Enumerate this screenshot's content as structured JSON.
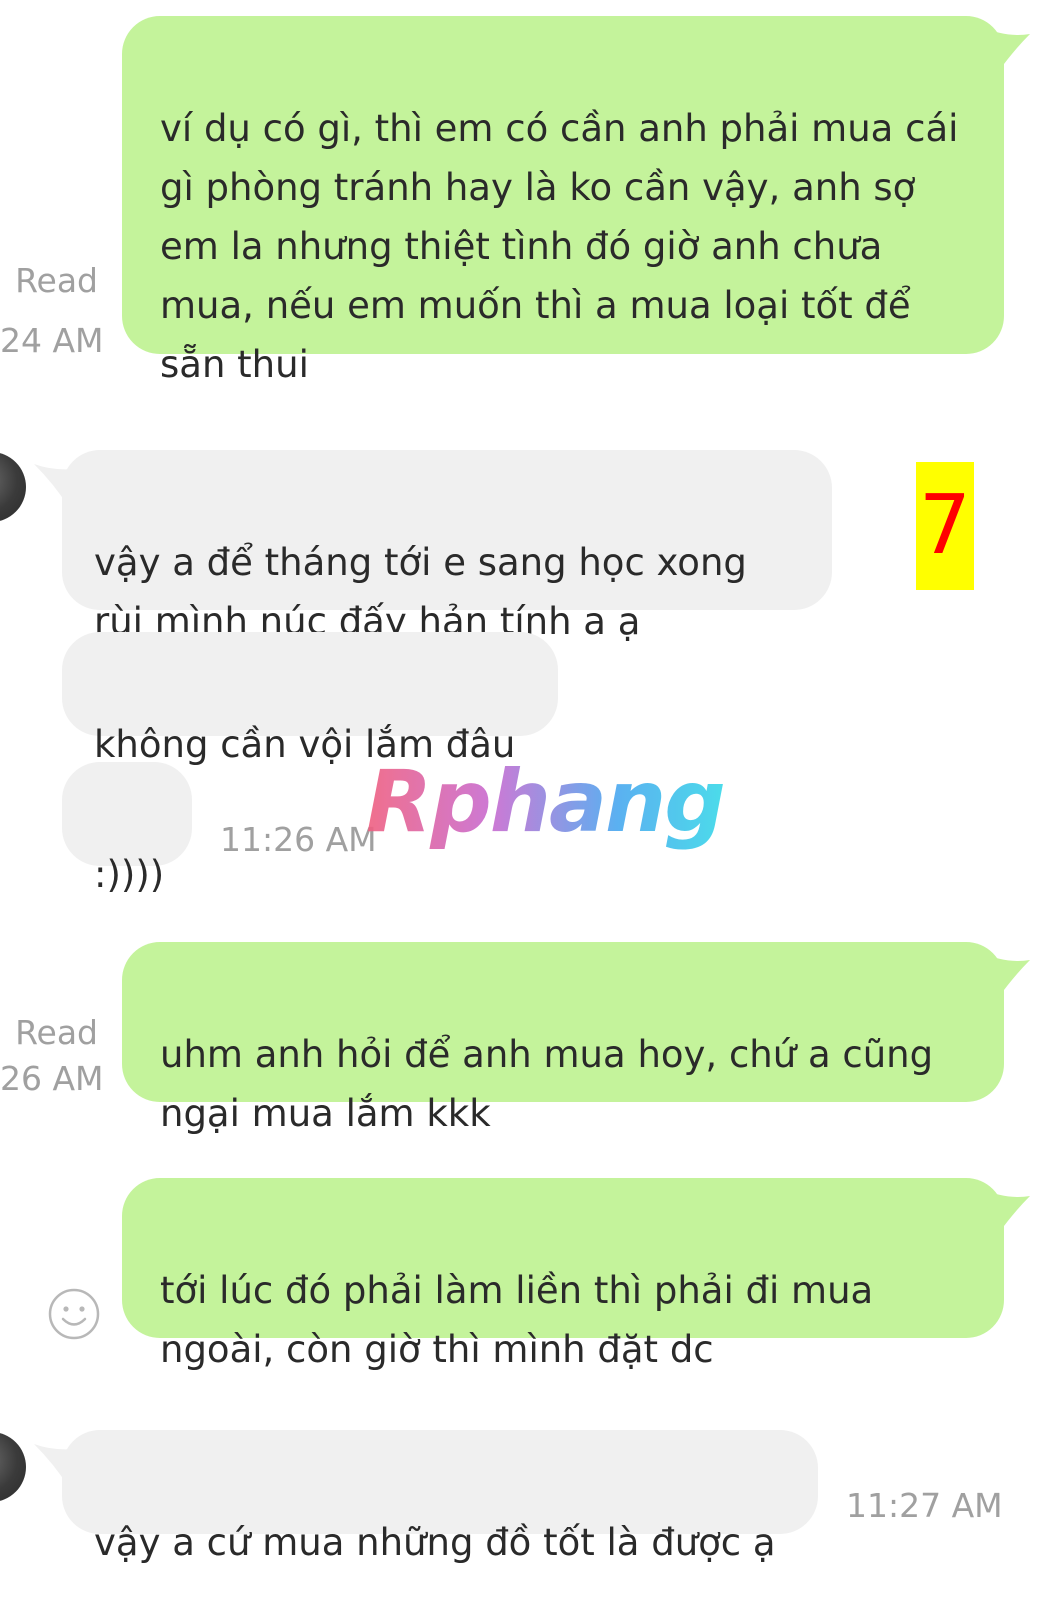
{
  "messages": [
    {
      "id": "m1",
      "side": "out",
      "text": "ví dụ có gì, thì em có cần anh phải mua cái\ngì phòng tránh hay là ko cần vậy, anh sợ\nem la nhưng thiệt tình đó giờ anh chưa\nmua, nếu em muốn thì a mua loại tốt để\nsẵn thui",
      "status": "Read",
      "time": "24 AM"
    },
    {
      "id": "m2",
      "side": "in",
      "text": "vậy a để tháng tới e sang học xong\nrùi mình núc đấy hản tính a ạ"
    },
    {
      "id": "m3",
      "side": "in",
      "text": "không cần vội lắm đâu"
    },
    {
      "id": "m4",
      "side": "in",
      "text": ":))))",
      "time": "11:26 AM"
    },
    {
      "id": "m5",
      "side": "out",
      "text": "uhm anh hỏi để anh mua hoy, chứ a cũng\nngại mua lắm kkk",
      "status": "Read",
      "time": "26 AM"
    },
    {
      "id": "m6",
      "side": "out",
      "text": "tới lúc đó phải làm liền thì phải đi mua\nngoài, còn giờ thì mình đặt dc"
    },
    {
      "id": "m7",
      "side": "in",
      "text": "vậy a cứ mua những đồ tốt là được ạ",
      "time": "11:27 AM"
    }
  ],
  "annotation": {
    "badge": "7"
  },
  "watermark": {
    "text": "Rphang"
  },
  "icons": {
    "avatar": "avatar-icon",
    "smiley": "smiley-icon"
  },
  "colors": {
    "outgoing_bubble": "#c4f39b",
    "incoming_bubble": "#f0f0f0",
    "timestamp": "#a0a0a0",
    "badge_bg": "#ffff00",
    "badge_text": "#ff0000"
  }
}
